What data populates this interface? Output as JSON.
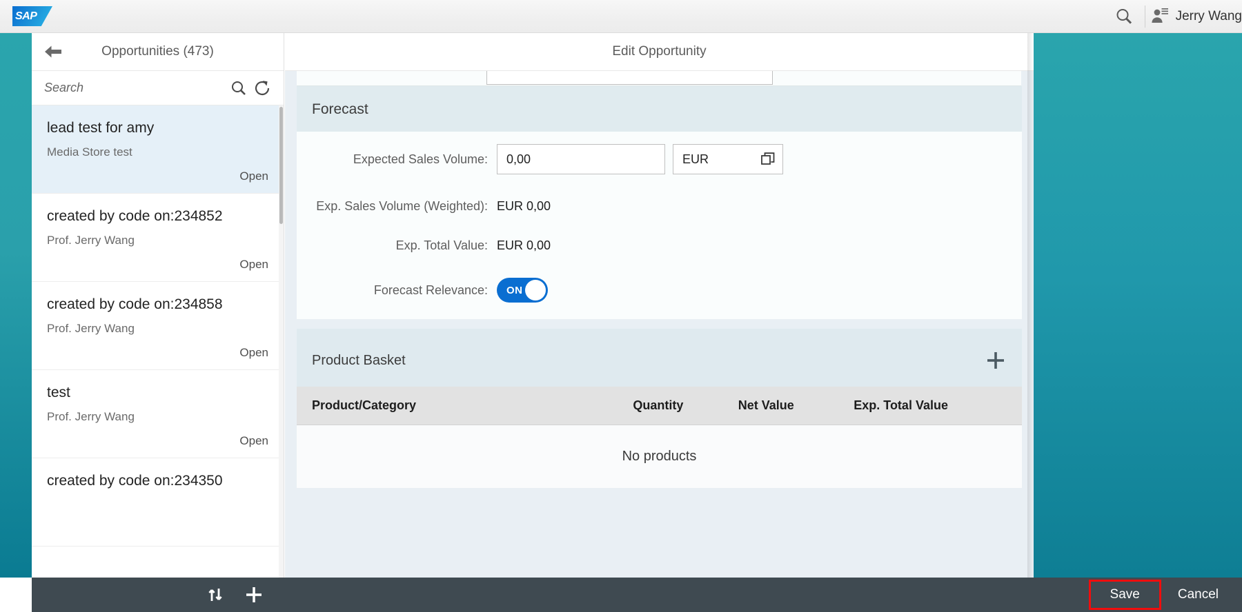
{
  "shell": {
    "logo_text": "SAP",
    "search_icon": "search-icon",
    "user_icon": "user-settings-icon",
    "user_name": "Jerry Wang"
  },
  "master": {
    "back_icon": "arrow-left-icon",
    "title": "Opportunities (473)",
    "search": {
      "placeholder": "Search",
      "value": "",
      "search_icon": "search-icon",
      "refresh_icon": "refresh-icon"
    },
    "items": [
      {
        "title": "lead test for amy",
        "subtitle": "Media Store test",
        "status": "Open",
        "selected": true
      },
      {
        "title": "created by code on:234852",
        "subtitle": "Prof. Jerry Wang",
        "status": "Open",
        "selected": false
      },
      {
        "title": "created by code on:234858",
        "subtitle": "Prof. Jerry Wang",
        "status": "Open",
        "selected": false
      },
      {
        "title": "test",
        "subtitle": "Prof. Jerry Wang",
        "status": "Open",
        "selected": false
      },
      {
        "title": "created by code on:234350",
        "subtitle": "",
        "status": "",
        "selected": false
      }
    ]
  },
  "detail": {
    "title": "Edit Opportunity",
    "forecast": {
      "heading": "Forecast",
      "expected_sales_volume_label": "Expected Sales Volume:",
      "expected_sales_volume_value": "0,00",
      "currency_value": "EUR",
      "currency_valuehelp_icon": "value-help-icon",
      "weighted_label": "Exp. Sales Volume (Weighted):",
      "weighted_value": "EUR 0,00",
      "total_label": "Exp. Total Value:",
      "total_value": "EUR 0,00",
      "relevance_label": "Forecast Relevance:",
      "relevance_state": "ON",
      "relevance_on": true
    },
    "product_basket": {
      "heading": "Product Basket",
      "add_icon": "plus-icon",
      "columns": [
        "Product/Category",
        "Quantity",
        "Net Value",
        "Exp. Total Value"
      ],
      "rows": [],
      "empty_text": "No products"
    }
  },
  "footer": {
    "sort_icon": "sort-icon",
    "add_icon": "plus-icon",
    "save_label": "Save",
    "cancel_label": "Cancel",
    "highlight_color": "#f10d0d"
  },
  "colors": {
    "brand_blue": "#0a6ed1",
    "teal": "#2aa5ad",
    "footer_bar": "#3f4a51",
    "selected_row": "#e5f0f8",
    "section_head": "#e0ebef"
  }
}
